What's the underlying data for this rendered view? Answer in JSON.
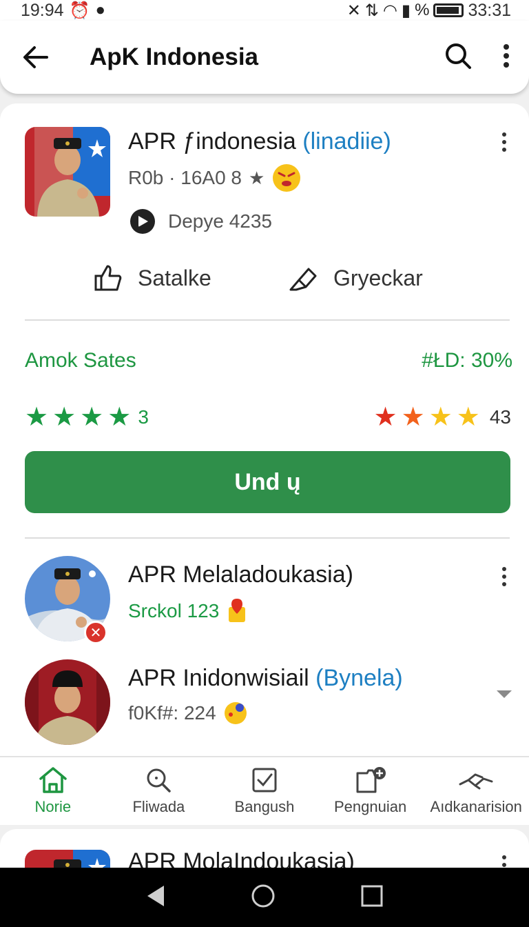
{
  "status_bar": {
    "time": "19:94",
    "right_text": "33:31"
  },
  "app_bar": {
    "title": "ApK Indonesia"
  },
  "featured_app": {
    "name": "APR ƒindonesia",
    "name_sub": "(linadiie)",
    "meta": "R0b · 16A0 8",
    "developer": "Depye 4235"
  },
  "actions": {
    "like_label": "Satalke",
    "share_label": "Gryeckar"
  },
  "stats": {
    "left_label": "Amok Sates",
    "right_label": "#ŁD: 30%",
    "left_rating_count": "3",
    "right_rating_count": "43",
    "left_stars": 4,
    "right_stars": 4,
    "colors": {
      "green": "#1b9a44",
      "red": "#e0301e",
      "orange": "#f2621c",
      "yellow": "#f7c21a"
    }
  },
  "install_button": {
    "label": "Und ų"
  },
  "list": [
    {
      "name": "APR Melaladoukasia)",
      "name_sub": "",
      "meta": "Srckol 123"
    },
    {
      "name": "APR Inidonwisiail",
      "name_sub": "(Bynela)",
      "meta": "f0Kf#: 224"
    }
  ],
  "bottom_nav": [
    {
      "label": "Norie",
      "icon": "home-icon"
    },
    {
      "label": "Fliwada",
      "icon": "search-icon"
    },
    {
      "label": "Bangush",
      "icon": "checkbox-icon"
    },
    {
      "label": "Pengnuian",
      "icon": "clipboard-add-icon"
    },
    {
      "label": "Aıdkanarision",
      "icon": "handshake-icon"
    }
  ],
  "peek_item": {
    "name": "APR MolaIndoukasia)"
  },
  "theme": {
    "accent": "#2f8f4a",
    "link": "#1d7fc2"
  }
}
